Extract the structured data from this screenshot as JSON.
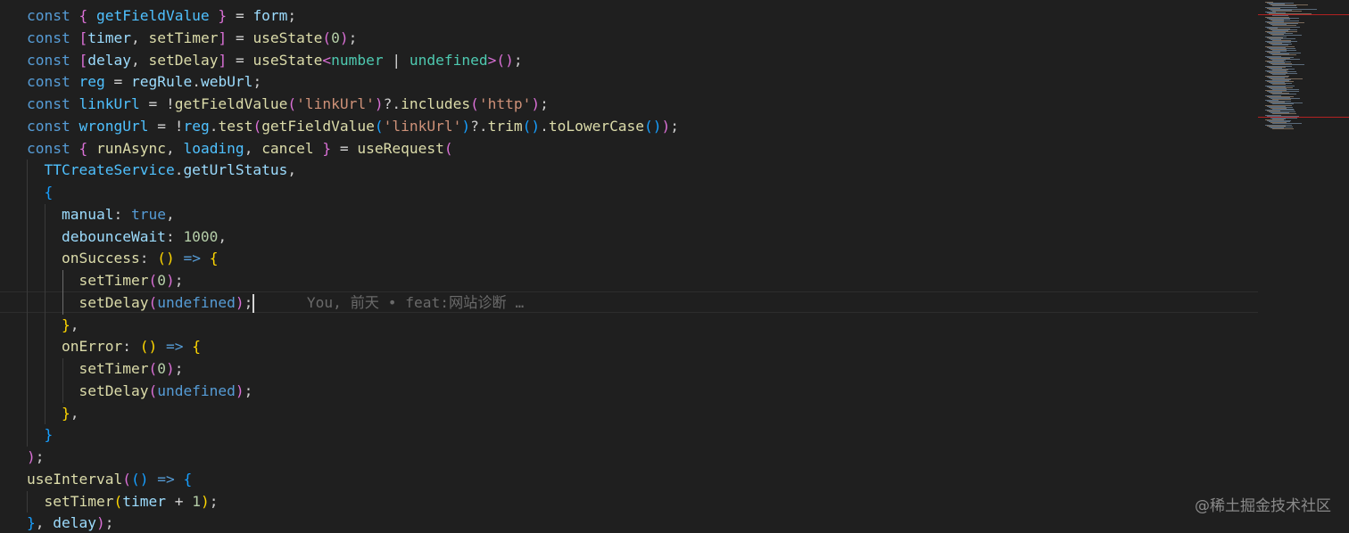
{
  "theme": {
    "background": "#1f1f1f",
    "token_colors": {
      "kw": "#569cd6",
      "var": "#9cdcfe",
      "fn": "#dcdcaa",
      "const": "#4fc1ff",
      "str": "#ce9178",
      "num": "#b5cea8",
      "type": "#4ec9b0",
      "punct": "#cccccc",
      "op": "#d4d4d4",
      "b1": "#ffd700",
      "b2": "#da70d6",
      "b3": "#179fff"
    },
    "indent_guide_color": "#3a3a3a",
    "minimap_error_color": "#b22222"
  },
  "editor": {
    "lines": [
      {
        "indent": 0,
        "tokens": [
          [
            "const ",
            "kw"
          ],
          [
            "{ ",
            "b2"
          ],
          [
            "getFieldValue",
            "const"
          ],
          [
            " } ",
            "b2"
          ],
          [
            "= ",
            "op"
          ],
          [
            "form",
            "var"
          ],
          [
            ";",
            "punct"
          ]
        ]
      },
      {
        "indent": 0,
        "tokens": [
          [
            "const ",
            "kw"
          ],
          [
            "[",
            "b2"
          ],
          [
            "timer",
            "var"
          ],
          [
            ", ",
            "punct"
          ],
          [
            "setTimer",
            "fn"
          ],
          [
            "] ",
            "b2"
          ],
          [
            "= ",
            "op"
          ],
          [
            "useState",
            "fn"
          ],
          [
            "(",
            "b2"
          ],
          [
            "0",
            "num"
          ],
          [
            ")",
            "b2"
          ],
          [
            ";",
            "punct"
          ]
        ]
      },
      {
        "indent": 0,
        "tokens": [
          [
            "const ",
            "kw"
          ],
          [
            "[",
            "b2"
          ],
          [
            "delay",
            "var"
          ],
          [
            ", ",
            "punct"
          ],
          [
            "setDelay",
            "fn"
          ],
          [
            "] ",
            "b2"
          ],
          [
            "= ",
            "op"
          ],
          [
            "useState",
            "fn"
          ],
          [
            "<",
            "b2"
          ],
          [
            "number",
            "type"
          ],
          [
            " | ",
            "op"
          ],
          [
            "undefined",
            "type"
          ],
          [
            ">",
            "b2"
          ],
          [
            "(",
            "b2"
          ],
          [
            ")",
            "b2"
          ],
          [
            ";",
            "punct"
          ]
        ]
      },
      {
        "indent": 0,
        "tokens": [
          [
            "const ",
            "kw"
          ],
          [
            "reg ",
            "const"
          ],
          [
            "= ",
            "op"
          ],
          [
            "regRule",
            "var"
          ],
          [
            ".",
            "punct"
          ],
          [
            "webUrl",
            "var"
          ],
          [
            ";",
            "punct"
          ]
        ]
      },
      {
        "indent": 0,
        "tokens": [
          [
            "const ",
            "kw"
          ],
          [
            "linkUrl ",
            "const"
          ],
          [
            "= ",
            "op"
          ],
          [
            "!",
            "op"
          ],
          [
            "getFieldValue",
            "fn"
          ],
          [
            "(",
            "b2"
          ],
          [
            "'linkUrl'",
            "str"
          ],
          [
            ")",
            "b2"
          ],
          [
            "?.",
            "punct"
          ],
          [
            "includes",
            "fn"
          ],
          [
            "(",
            "b2"
          ],
          [
            "'http'",
            "str"
          ],
          [
            ")",
            "b2"
          ],
          [
            ";",
            "punct"
          ]
        ]
      },
      {
        "indent": 0,
        "tokens": [
          [
            "const ",
            "kw"
          ],
          [
            "wrongUrl ",
            "const"
          ],
          [
            "= ",
            "op"
          ],
          [
            "!",
            "op"
          ],
          [
            "reg",
            "const"
          ],
          [
            ".",
            "punct"
          ],
          [
            "test",
            "fn"
          ],
          [
            "(",
            "b2"
          ],
          [
            "getFieldValue",
            "fn"
          ],
          [
            "(",
            "b3"
          ],
          [
            "'linkUrl'",
            "str"
          ],
          [
            ")",
            "b3"
          ],
          [
            "?.",
            "punct"
          ],
          [
            "trim",
            "fn"
          ],
          [
            "(",
            "b3"
          ],
          [
            ")",
            "b3"
          ],
          [
            ".",
            "punct"
          ],
          [
            "toLowerCase",
            "fn"
          ],
          [
            "(",
            "b3"
          ],
          [
            ")",
            "b3"
          ],
          [
            ")",
            "b2"
          ],
          [
            ";",
            "punct"
          ]
        ]
      },
      {
        "indent": 0,
        "tokens": [
          [
            "const ",
            "kw"
          ],
          [
            "{ ",
            "b2"
          ],
          [
            "runAsync",
            "fn"
          ],
          [
            ", ",
            "punct"
          ],
          [
            "loading",
            "const"
          ],
          [
            ", ",
            "punct"
          ],
          [
            "cancel",
            "fn"
          ],
          [
            " } ",
            "b2"
          ],
          [
            "= ",
            "op"
          ],
          [
            "useRequest",
            "fn"
          ],
          [
            "(",
            "b2"
          ]
        ]
      },
      {
        "indent": 1,
        "tokens": [
          [
            "TTCreateService",
            "const"
          ],
          [
            ".",
            "punct"
          ],
          [
            "getUrlStatus",
            "var"
          ],
          [
            ",",
            "punct"
          ]
        ]
      },
      {
        "indent": 1,
        "tokens": [
          [
            "{",
            "b3"
          ]
        ]
      },
      {
        "indent": 2,
        "tokens": [
          [
            "manual",
            "var"
          ],
          [
            ": ",
            "punct"
          ],
          [
            "true",
            "kw"
          ],
          [
            ",",
            "punct"
          ]
        ]
      },
      {
        "indent": 2,
        "tokens": [
          [
            "debounceWait",
            "var"
          ],
          [
            ": ",
            "punct"
          ],
          [
            "1000",
            "num"
          ],
          [
            ",",
            "punct"
          ]
        ]
      },
      {
        "indent": 2,
        "tokens": [
          [
            "onSuccess",
            "fn"
          ],
          [
            ": ",
            "punct"
          ],
          [
            "()",
            "b1"
          ],
          [
            " => ",
            "kw"
          ],
          [
            "{",
            "b1"
          ]
        ]
      },
      {
        "indent": 3,
        "tokens": [
          [
            "setTimer",
            "fn"
          ],
          [
            "(",
            "b2"
          ],
          [
            "0",
            "num"
          ],
          [
            ")",
            "b2"
          ],
          [
            ";",
            "punct"
          ]
        ]
      },
      {
        "indent": 3,
        "tokens": [
          [
            "setDelay",
            "fn"
          ],
          [
            "(",
            "b2"
          ],
          [
            "undefined",
            "kw"
          ],
          [
            ")",
            "b2"
          ],
          [
            ";",
            "punct"
          ]
        ],
        "cursor": true,
        "blame": "You, 前天 • feat:网站诊断 …"
      },
      {
        "indent": 2,
        "tokens": [
          [
            "}",
            "b1"
          ],
          [
            ",",
            "punct"
          ]
        ]
      },
      {
        "indent": 2,
        "tokens": [
          [
            "onError",
            "fn"
          ],
          [
            ": ",
            "punct"
          ],
          [
            "()",
            "b1"
          ],
          [
            " => ",
            "kw"
          ],
          [
            "{",
            "b1"
          ]
        ]
      },
      {
        "indent": 3,
        "tokens": [
          [
            "setTimer",
            "fn"
          ],
          [
            "(",
            "b2"
          ],
          [
            "0",
            "num"
          ],
          [
            ")",
            "b2"
          ],
          [
            ";",
            "punct"
          ]
        ]
      },
      {
        "indent": 3,
        "tokens": [
          [
            "setDelay",
            "fn"
          ],
          [
            "(",
            "b2"
          ],
          [
            "undefined",
            "kw"
          ],
          [
            ")",
            "b2"
          ],
          [
            ";",
            "punct"
          ]
        ]
      },
      {
        "indent": 2,
        "tokens": [
          [
            "}",
            "b1"
          ],
          [
            ",",
            "punct"
          ]
        ]
      },
      {
        "indent": 1,
        "tokens": [
          [
            "}",
            "b3"
          ]
        ]
      },
      {
        "indent": 0,
        "tokens": [
          [
            ")",
            "b2"
          ],
          [
            ";",
            "punct"
          ]
        ]
      },
      {
        "indent": 0,
        "tokens": [
          [
            "useInterval",
            "fn"
          ],
          [
            "(",
            "b2"
          ],
          [
            "()",
            "b3"
          ],
          [
            " => ",
            "kw"
          ],
          [
            "{",
            "b3"
          ]
        ]
      },
      {
        "indent": 1,
        "tokens": [
          [
            "setTimer",
            "fn"
          ],
          [
            "(",
            "b1"
          ],
          [
            "timer ",
            "var"
          ],
          [
            "+ ",
            "op"
          ],
          [
            "1",
            "num"
          ],
          [
            ")",
            "b1"
          ],
          [
            ";",
            "punct"
          ]
        ]
      },
      {
        "indent": 0,
        "tokens": [
          [
            "}",
            "b3"
          ],
          [
            ", ",
            "punct"
          ],
          [
            "delay",
            "var"
          ],
          [
            ")",
            "b2"
          ],
          [
            ";",
            "punct"
          ]
        ]
      }
    ]
  },
  "watermark": "@稀土掘金技术社区"
}
